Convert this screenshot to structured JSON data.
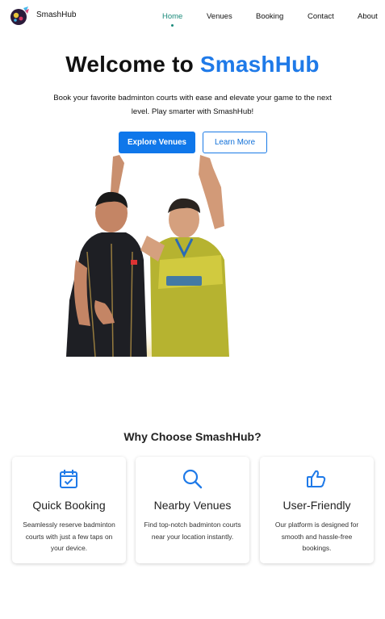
{
  "nav": {
    "brand": "SmashHub",
    "links": [
      "Home",
      "Venues",
      "Booking",
      "Contact",
      "About"
    ],
    "active": "Home"
  },
  "hero": {
    "title_prefix": "Welcome to",
    "title_accent": "SmashHub",
    "subtitle": "Book your favorite badminton courts with ease and elevate your game to the next level. Play smarter with SmashHub!",
    "primary_button": "Explore Venues",
    "secondary_button": "Learn More"
  },
  "features": {
    "title": "Why Choose SmashHub?",
    "cards": [
      {
        "icon": "calendar-check-icon",
        "title": "Quick Booking",
        "desc": "Seamlessly reserve badminton courts with just a few taps on your device."
      },
      {
        "icon": "search-icon",
        "title": "Nearby Venues",
        "desc": "Find top-notch badminton courts near your location instantly."
      },
      {
        "icon": "thumbs-up-icon",
        "title": "User-Friendly",
        "desc": "Our platform is designed for smooth and hassle-free bookings."
      }
    ]
  },
  "colors": {
    "accent": "#1f7ae8",
    "active_nav": "#1a8a7a",
    "button": "#0f77ea"
  }
}
